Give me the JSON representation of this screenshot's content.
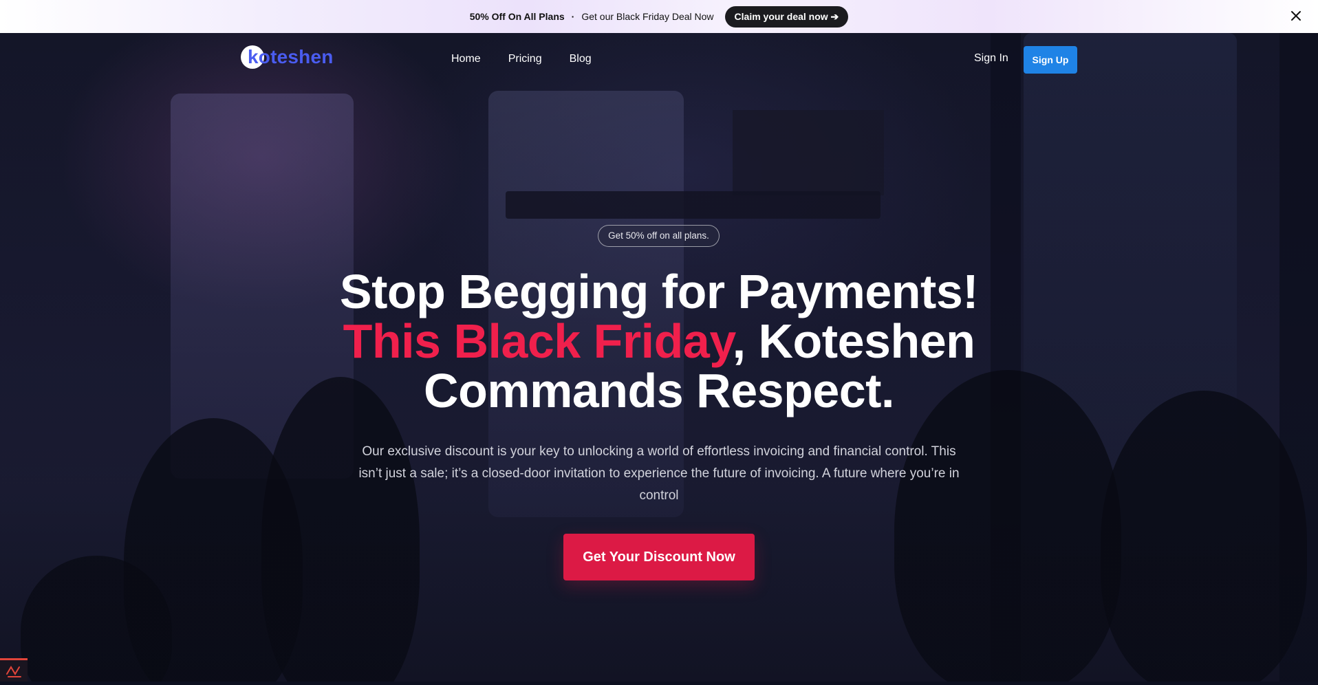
{
  "promo": {
    "strong_text": "50% Off On All Plans",
    "separator": "·",
    "text": "Get our Black Friday Deal Now",
    "cta_label": "Claim your deal now ➔",
    "close_icon": "close-icon"
  },
  "nav": {
    "logo_text": "koteshen",
    "links": [
      "Home",
      "Pricing",
      "Blog"
    ],
    "sign_in": "Sign In",
    "sign_up": "Sign Up"
  },
  "hero": {
    "pill": "Get 50% off on all plans.",
    "headline_line1": "Stop Begging for Payments!",
    "headline_accent": "This Black Friday",
    "headline_rest": ", Koteshen",
    "headline_line3": "Commands Respect.",
    "subtext": "Our exclusive discount is your key to unlocking a world of effortless invoicing and financial control. This isn’t just a sale; it’s a closed-door invitation to experience the future of invoicing. A future where you’re in control",
    "cta_label": "Get Your Discount Now"
  },
  "colors": {
    "accent_red": "#f0204c",
    "cta_red": "#dc1a45",
    "signup_blue": "#1f83e6",
    "logo_blue": "#4a5cf0"
  }
}
